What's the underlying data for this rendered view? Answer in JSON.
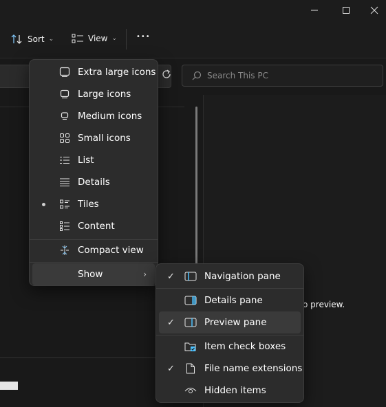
{
  "window": {
    "minimize_glyph": "—",
    "maximize_glyph": "☐",
    "close_glyph": "✕"
  },
  "toolbar": {
    "sort_label": "Sort",
    "view_label": "View",
    "more_glyph": "•••",
    "chevron": "⌄"
  },
  "search": {
    "placeholder": "Search This PC"
  },
  "preview": {
    "message": "o preview."
  },
  "view_menu": {
    "items": [
      {
        "label": "Extra large icons",
        "icon": "extra-large-icons-icon"
      },
      {
        "label": "Large icons",
        "icon": "large-icons-icon"
      },
      {
        "label": "Medium icons",
        "icon": "medium-icons-icon"
      },
      {
        "label": "Small icons",
        "icon": "small-icons-icon"
      },
      {
        "label": "List",
        "icon": "list-icon"
      },
      {
        "label": "Details",
        "icon": "details-icon"
      },
      {
        "label": "Tiles",
        "icon": "tiles-icon",
        "selected": true
      },
      {
        "label": "Content",
        "icon": "content-icon"
      }
    ],
    "compact_label": "Compact view",
    "show_label": "Show",
    "submenu_arrow": "›"
  },
  "show_menu": {
    "check_glyph": "✓",
    "items": [
      {
        "label": "Navigation pane",
        "icon": "navigation-pane-icon",
        "checked": true
      },
      {
        "label": "Details pane",
        "icon": "details-pane-icon",
        "checked": false
      },
      {
        "label": "Preview pane",
        "icon": "preview-pane-icon",
        "checked": true
      },
      {
        "label": "Item check boxes",
        "icon": "item-check-boxes-icon",
        "checked": false
      },
      {
        "label": "File name extensions",
        "icon": "file-name-extensions-icon",
        "checked": true
      },
      {
        "label": "Hidden items",
        "icon": "hidden-items-icon",
        "checked": false
      }
    ]
  },
  "colors": {
    "accent": "#4cc2ff",
    "menu_bg": "#2c2c2c",
    "highlight": "#3a3a3a"
  }
}
